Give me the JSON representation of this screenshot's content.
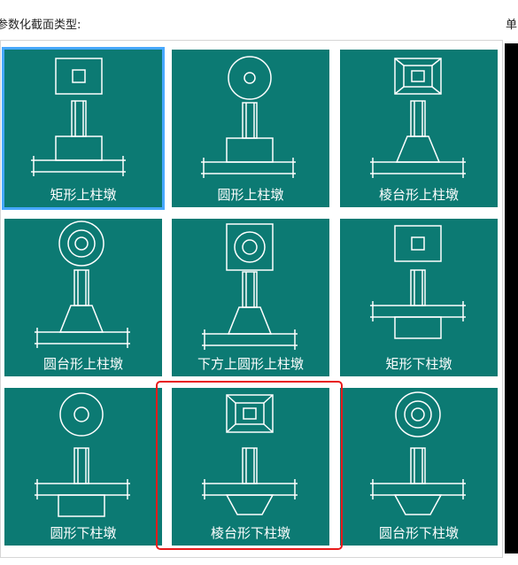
{
  "section_title": "参数化截面类型:",
  "right_label": "单",
  "tiles": [
    {
      "label": "矩形上柱墩",
      "icon": "rect-top-pier-icon"
    },
    {
      "label": "圆形上柱墩",
      "icon": "circle-top-pier-icon"
    },
    {
      "label": "棱台形上柱墩",
      "icon": "frustum-top-pier-icon"
    },
    {
      "label": "圆台形上柱墩",
      "icon": "cone-frustum-top-pier-icon"
    },
    {
      "label": "下方上圆形上柱墩",
      "icon": "square-bottom-round-top-pier-icon"
    },
    {
      "label": "矩形下柱墩",
      "icon": "rect-bottom-pier-icon"
    },
    {
      "label": "圆形下柱墩",
      "icon": "circle-bottom-pier-icon"
    },
    {
      "label": "棱台形下柱墩",
      "icon": "frustum-bottom-pier-icon"
    },
    {
      "label": "圆台形下柱墩",
      "icon": "cone-frustum-bottom-pier-icon"
    }
  ],
  "selected_index": 0,
  "highlighted_index": 7,
  "colors": {
    "tile_bg": "#0c7a73",
    "selection": "#47a8ff",
    "highlight": "#e81b1b"
  }
}
